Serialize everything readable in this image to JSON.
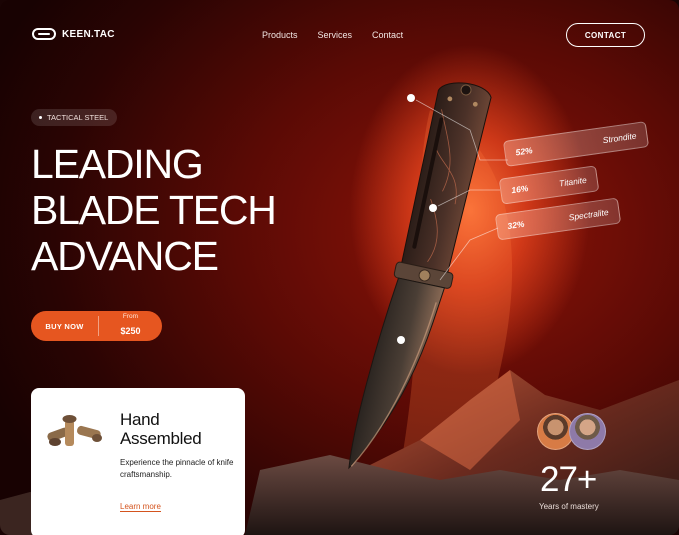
{
  "brand": {
    "logo_icon": "blade-logo-icon",
    "name": "KEEN.TAC"
  },
  "nav": {
    "items": [
      "Products",
      "Services",
      "Contact"
    ]
  },
  "header": {
    "contact_label": "CONTACT"
  },
  "hero": {
    "tag": "TACTICAL STEEL",
    "headline": [
      "LEADING",
      "BLADE TECH",
      "ADVANCE"
    ],
    "buy_label": "BUY NOW",
    "price_from": "From",
    "price": "$250",
    "accent_color": "#e65620"
  },
  "card": {
    "title": [
      "Hand",
      "Assembled"
    ],
    "description": "Experience the pinnacle of knife craftsmanship.",
    "link": "Learn more"
  },
  "materials": [
    {
      "percent": "52%",
      "name": "Strondite"
    },
    {
      "percent": "16%",
      "name": "Titanite"
    },
    {
      "percent": "32%",
      "name": "Spectralite"
    }
  ],
  "mastery": {
    "value": "27+",
    "label": "Years of mastery"
  }
}
